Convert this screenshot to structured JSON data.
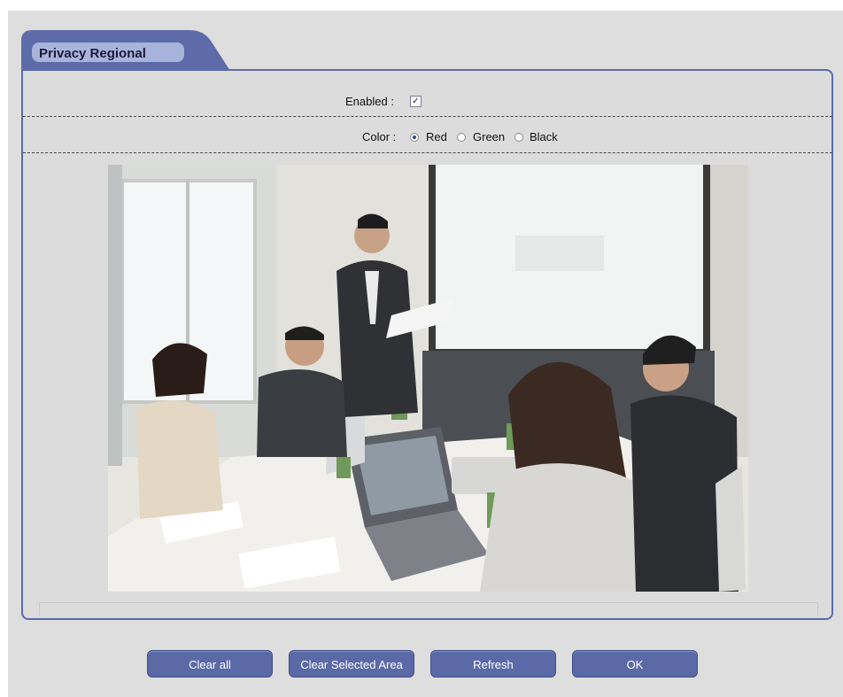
{
  "tab": {
    "title": "Privacy Regional"
  },
  "enabled": {
    "label": "Enabled :",
    "checked": true,
    "check_glyph": "✓"
  },
  "color": {
    "label": "Color :",
    "options": [
      {
        "label": "Red",
        "selected": true
      },
      {
        "label": "Green",
        "selected": false
      },
      {
        "label": "Black",
        "selected": false
      }
    ]
  },
  "buttons": {
    "clear_all": "Clear all",
    "clear_selected": "Clear Selected Area",
    "refresh": "Refresh",
    "ok": "OK"
  },
  "colors": {
    "accent": "#5b6aa6",
    "panel_border": "#5d6ba8",
    "background": "#dedede"
  }
}
